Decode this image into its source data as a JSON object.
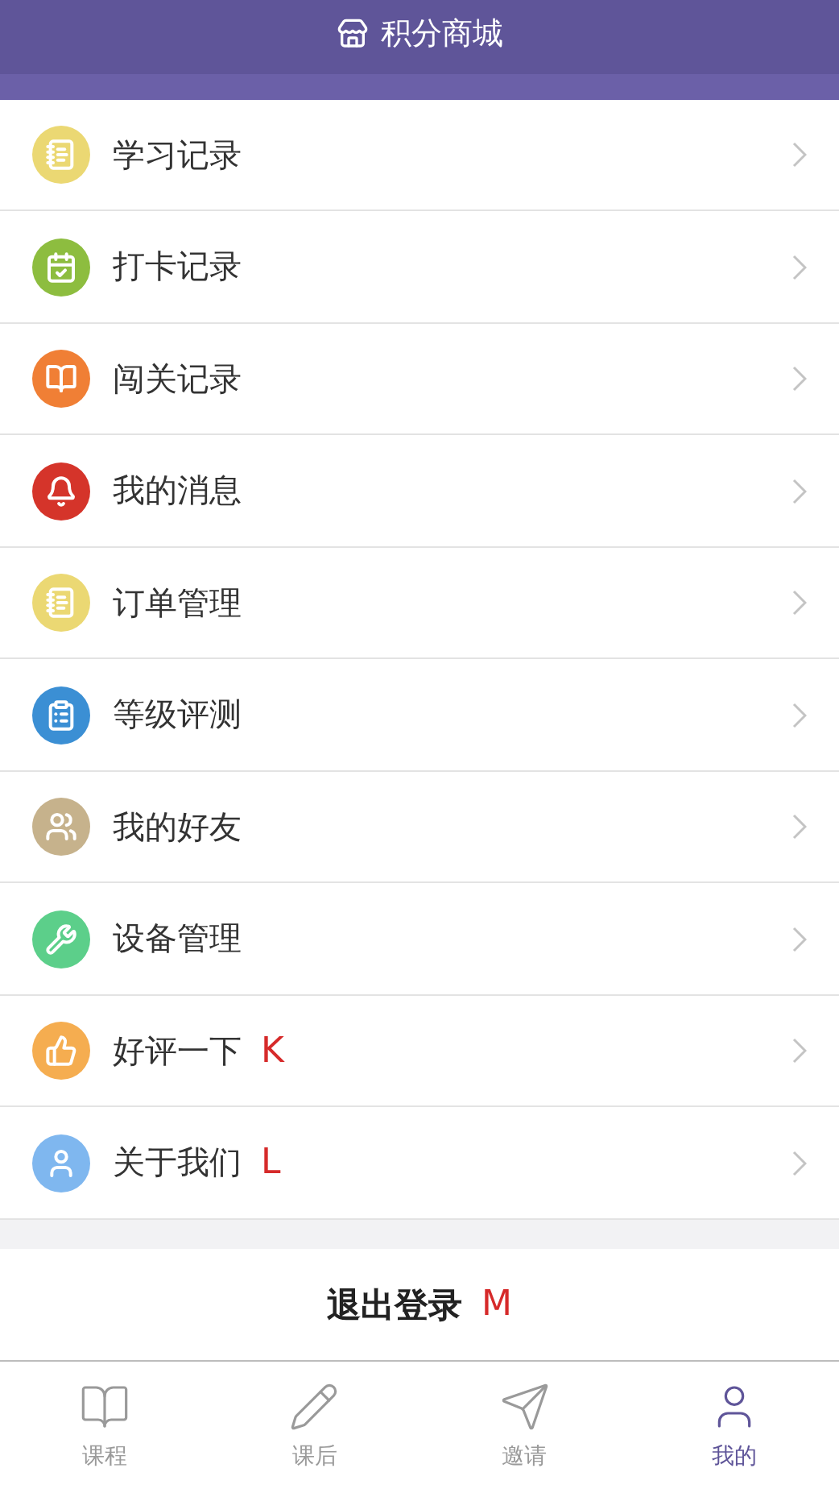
{
  "header": {
    "title": "积分商城"
  },
  "menu_items": [
    {
      "label": "学习记录",
      "color": "#ebd873"
    },
    {
      "label": "打卡记录",
      "color": "#8dbd3f"
    },
    {
      "label": "闯关记录",
      "color": "#f07f35"
    },
    {
      "label": "我的消息",
      "color": "#d5342a"
    },
    {
      "label": "订单管理",
      "color": "#ebd873"
    },
    {
      "label": "等级评测",
      "color": "#3b8fd4"
    },
    {
      "label": "我的好友",
      "color": "#c6b28c"
    },
    {
      "label": "设备管理",
      "color": "#5ccf8a"
    },
    {
      "label": "好评一下",
      "color": "#f5ad50",
      "annotation": "K"
    },
    {
      "label": "关于我们",
      "color": "#7fb7ef",
      "annotation": "L"
    }
  ],
  "logout": {
    "label": "退出登录",
    "annotation": "M"
  },
  "tabs": [
    {
      "label": "课程",
      "selected": false
    },
    {
      "label": "课后",
      "selected": false
    },
    {
      "label": "邀请",
      "selected": false
    },
    {
      "label": "我的",
      "selected": true
    }
  ]
}
